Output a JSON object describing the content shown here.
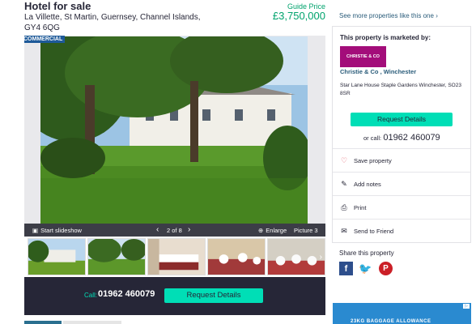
{
  "listing": {
    "title": "Hotel for sale",
    "address": "La Villette, St Martin, Guernsey, Channel Islands, GY4 6QG",
    "price_label": "Guide Price",
    "price": "£3,750,000",
    "badge": "COMMERCIAL"
  },
  "gallery": {
    "slideshow_label": "Start slideshow",
    "counter": "2 of 8",
    "enlarge_label": "Enlarge",
    "picture_label": "Picture 3",
    "prev_arrow": "‹",
    "next_arrow": "›",
    "thumbnail_count": 5
  },
  "cta": {
    "call_label": "Call:",
    "phone": "01962 460079",
    "button_label": "Request Details"
  },
  "sidebar": {
    "see_more_link": "See more properties like this one",
    "marketed_by_label": "This property is marketed by:",
    "logo_text": "CHRISTIE & CO",
    "agent_name": "Christie & Co , Winchester",
    "agent_address": "Star Lane House Staple Gardens Winchester, SO23 8SR",
    "request_button": "Request Details",
    "or_call_label": "or call:",
    "or_call_phone": "01962 460079",
    "actions": [
      {
        "label": "Save property",
        "icon": "heart-icon"
      },
      {
        "label": "Add notes",
        "icon": "pencil-icon"
      },
      {
        "label": "Print",
        "icon": "printer-icon"
      },
      {
        "label": "Send to Friend",
        "icon": "envelope-icon"
      }
    ]
  },
  "share": {
    "label": "Share this property",
    "networks": [
      "facebook",
      "twitter",
      "pinterest"
    ]
  },
  "ad": {
    "text": "23KG BAGGAGE ALLOWANCE"
  },
  "colors": {
    "accent_green": "#00a36d",
    "cta_teal": "#00deb6",
    "dark_navy": "#262637",
    "badge_blue": "#1e5a99",
    "link_blue": "#2a5c7a",
    "agent_logo": "#a30d7a"
  }
}
